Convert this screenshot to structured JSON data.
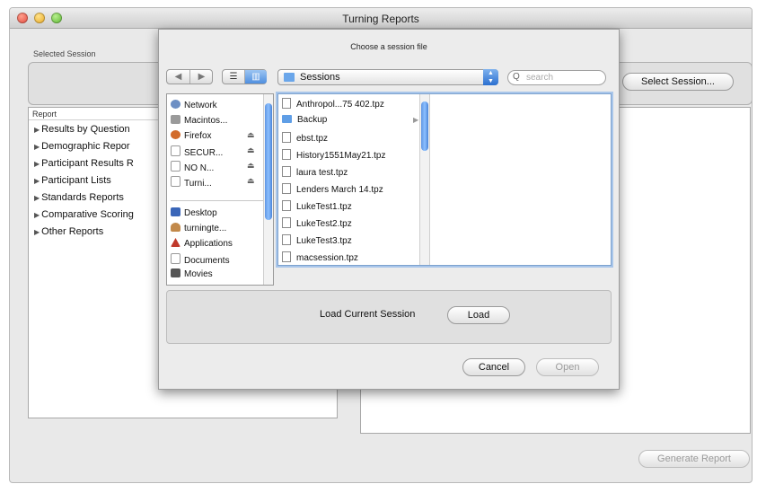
{
  "window": {
    "title": "Turning Reports"
  },
  "main": {
    "selected_session_label": "Selected Session",
    "select_session_button": "Select Session...",
    "report_header": "Report",
    "reports": [
      "Results by Question",
      "Demographic Repor",
      "Participant Results R",
      "Participant Lists",
      "Standards Reports",
      "Comparative Scoring",
      "Other Reports"
    ],
    "generate_button": "Generate Report"
  },
  "dialog": {
    "title": "Choose a session file",
    "location": "Sessions",
    "search_placeholder": "search",
    "sidebar_devices": [
      {
        "label": "Network",
        "icon": "network-icon",
        "eject": ""
      },
      {
        "label": "Macintos...",
        "icon": "hard-drive-icon",
        "eject": ""
      },
      {
        "label": "Firefox",
        "icon": "firefox-disk-icon",
        "eject": "⏏"
      },
      {
        "label": "SECUR...",
        "icon": "disk-icon",
        "eject": "⏏"
      },
      {
        "label": "NO N...",
        "icon": "disk-icon",
        "eject": "⏏"
      },
      {
        "label": "Turni...",
        "icon": "disk-icon",
        "eject": "⏏"
      }
    ],
    "sidebar_places": [
      {
        "label": "Desktop",
        "icon": "desktop-icon"
      },
      {
        "label": "turningte...",
        "icon": "home-icon"
      },
      {
        "label": "Applications",
        "icon": "applications-icon"
      },
      {
        "label": "Documents",
        "icon": "documents-icon"
      },
      {
        "label": "Movies",
        "icon": "movies-icon"
      }
    ],
    "files": [
      {
        "name": "Anthropol...75 402.tpz",
        "type": "file"
      },
      {
        "name": "Backup",
        "type": "folder"
      },
      {
        "name": "ebst.tpz",
        "type": "file"
      },
      {
        "name": "History1551May21.tpz",
        "type": "file"
      },
      {
        "name": "laura test.tpz",
        "type": "file"
      },
      {
        "name": "Lenders March 14.tpz",
        "type": "file"
      },
      {
        "name": "LukeTest1.tpz",
        "type": "file"
      },
      {
        "name": "LukeTest2.tpz",
        "type": "file"
      },
      {
        "name": "LukeTest3.tpz",
        "type": "file"
      },
      {
        "name": "macsession.tpz",
        "type": "file"
      }
    ],
    "load_current_label": "Load Current Session",
    "load_button": "Load",
    "cancel_button": "Cancel",
    "open_button": "Open"
  },
  "colors": {
    "accent": "#3b7fd9",
    "selection_blue": "#a9c6ea"
  }
}
